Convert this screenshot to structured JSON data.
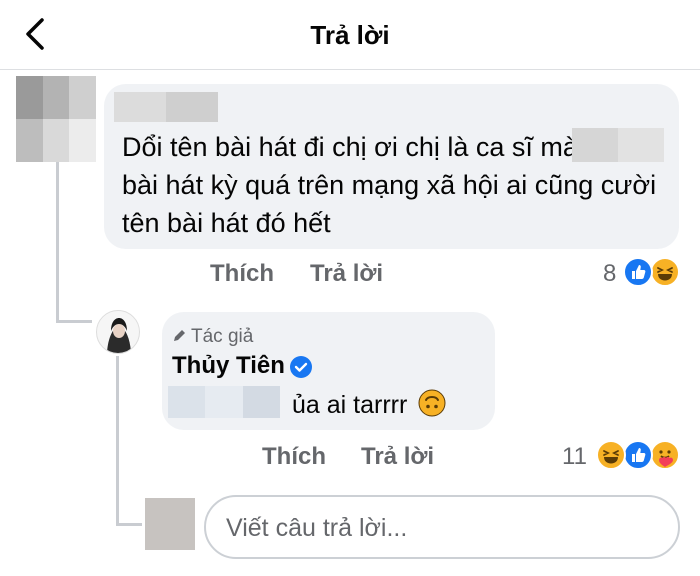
{
  "header": {
    "title": "Trả lời",
    "back_icon": "chevron-left-icon"
  },
  "comment": {
    "text": "Dổi tên bài hát đi chị ơi chị là ca sĩ                 mà tên bài hát kỳ quá trên mạng xã hội ai cũng cười tên bài hát đó hết",
    "actions": {
      "like": "Thích",
      "reply": "Trả lời"
    },
    "reaction_count": "8",
    "reactions": [
      "like-reaction-icon",
      "haha-reaction-icon"
    ]
  },
  "reply": {
    "author_tag": "Tác giả",
    "author_icon": "pencil-icon",
    "author_name": "Thủy Tiên",
    "verified_icon": "verified-badge-icon",
    "text": "ủa ai tarrrr",
    "emoji": "upside-down-face-icon",
    "actions": {
      "like": "Thích",
      "reply": "Trả lời"
    },
    "reaction_count": "11",
    "reactions": [
      "haha-reaction-icon",
      "like-reaction-icon",
      "care-reaction-icon"
    ]
  },
  "composer": {
    "placeholder": "Viết câu trả lời..."
  },
  "colors": {
    "bubble": "#f0f2f5",
    "secondary_text": "#65676b",
    "like_blue": "#1877f2",
    "reaction_yellow": "#f7b125"
  }
}
